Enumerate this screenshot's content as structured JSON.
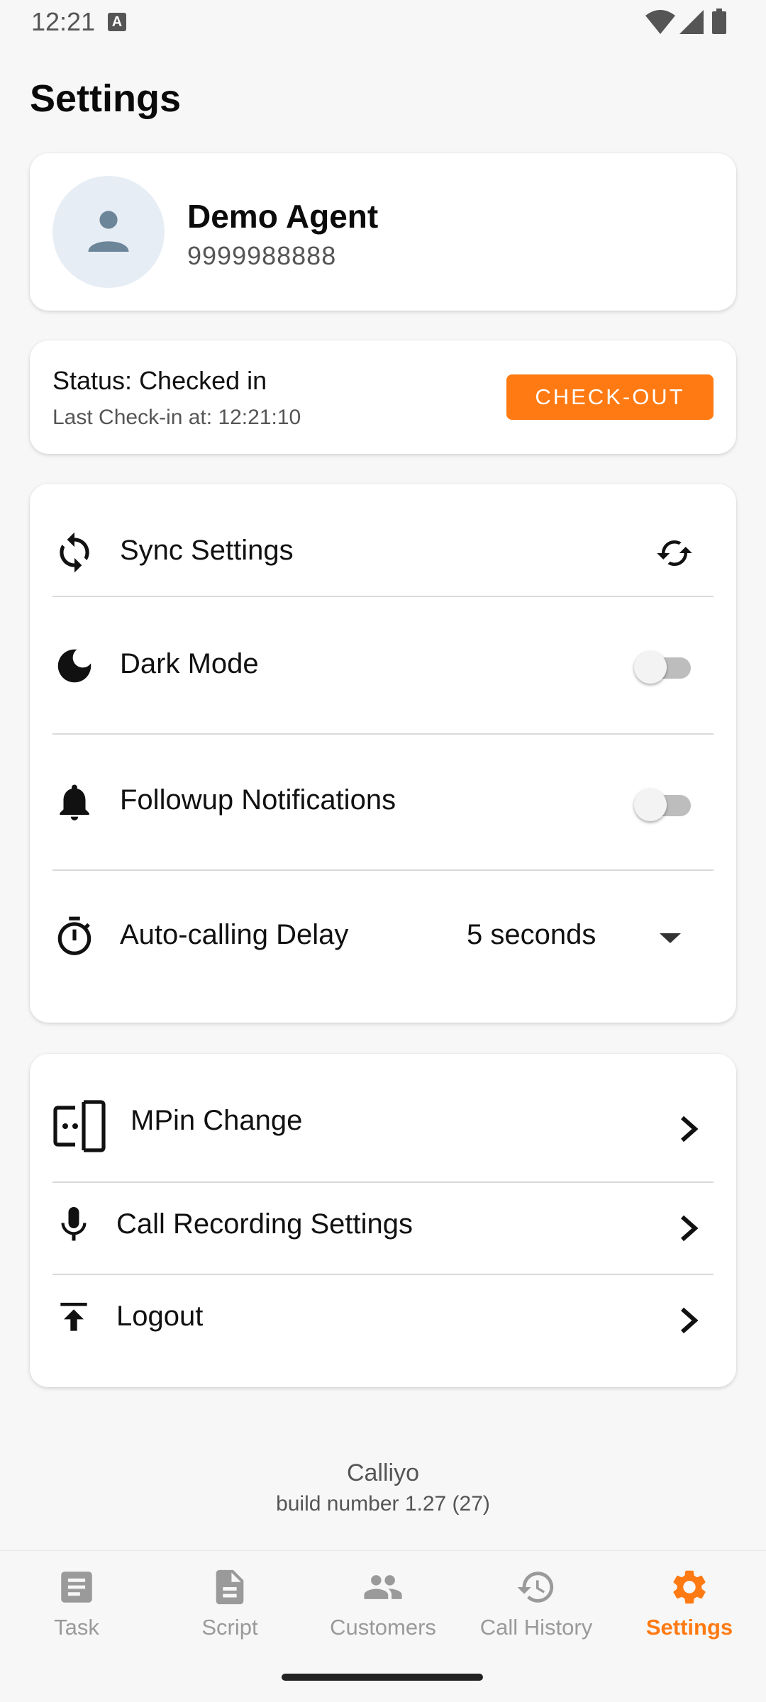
{
  "status_bar": {
    "time": "12:21",
    "notification_icon": "a-badge-icon",
    "icons": [
      "wifi-icon",
      "signal-icon",
      "battery-icon"
    ]
  },
  "header": {
    "title": "Settings"
  },
  "profile": {
    "name": "Demo Agent",
    "phone": "9999988888",
    "avatar_icon": "person-icon"
  },
  "checkin": {
    "status_text": "Status: Checked in",
    "last_checkin_text": "Last Check-in at: 12:21:10",
    "button_label": "CHECK-OUT"
  },
  "settings": {
    "sync": {
      "label": "Sync Settings",
      "icon": "sync-icon"
    },
    "dark_mode": {
      "label": "Dark Mode",
      "icon": "moon-icon",
      "enabled": false
    },
    "followup": {
      "label": "Followup Notifications",
      "icon": "bell-icon",
      "enabled": false
    },
    "auto_delay": {
      "label": "Auto-calling Delay",
      "icon": "timer-icon",
      "value": "5 seconds"
    }
  },
  "account": {
    "mpin": {
      "label": "MPin Change",
      "icon": "mpin-icon"
    },
    "recording": {
      "label": "Call Recording Settings",
      "icon": "mic-icon"
    },
    "logout": {
      "label": "Logout",
      "icon": "logout-icon"
    }
  },
  "footer": {
    "app_name": "Calliyo",
    "build": "build number 1.27 (27)"
  },
  "bottom_nav": {
    "items": [
      {
        "label": "Task",
        "icon": "task-icon"
      },
      {
        "label": "Script",
        "icon": "script-icon"
      },
      {
        "label": "Customers",
        "icon": "customers-icon"
      },
      {
        "label": "Call History",
        "icon": "history-icon"
      },
      {
        "label": "Settings",
        "icon": "gear-icon"
      }
    ],
    "active": "Settings"
  },
  "colors": {
    "accent": "#ff7a12",
    "background": "#f7f7f7",
    "card": "#ffffff",
    "avatar_bg": "#e6edf5",
    "avatar_fg": "#6d8599"
  }
}
